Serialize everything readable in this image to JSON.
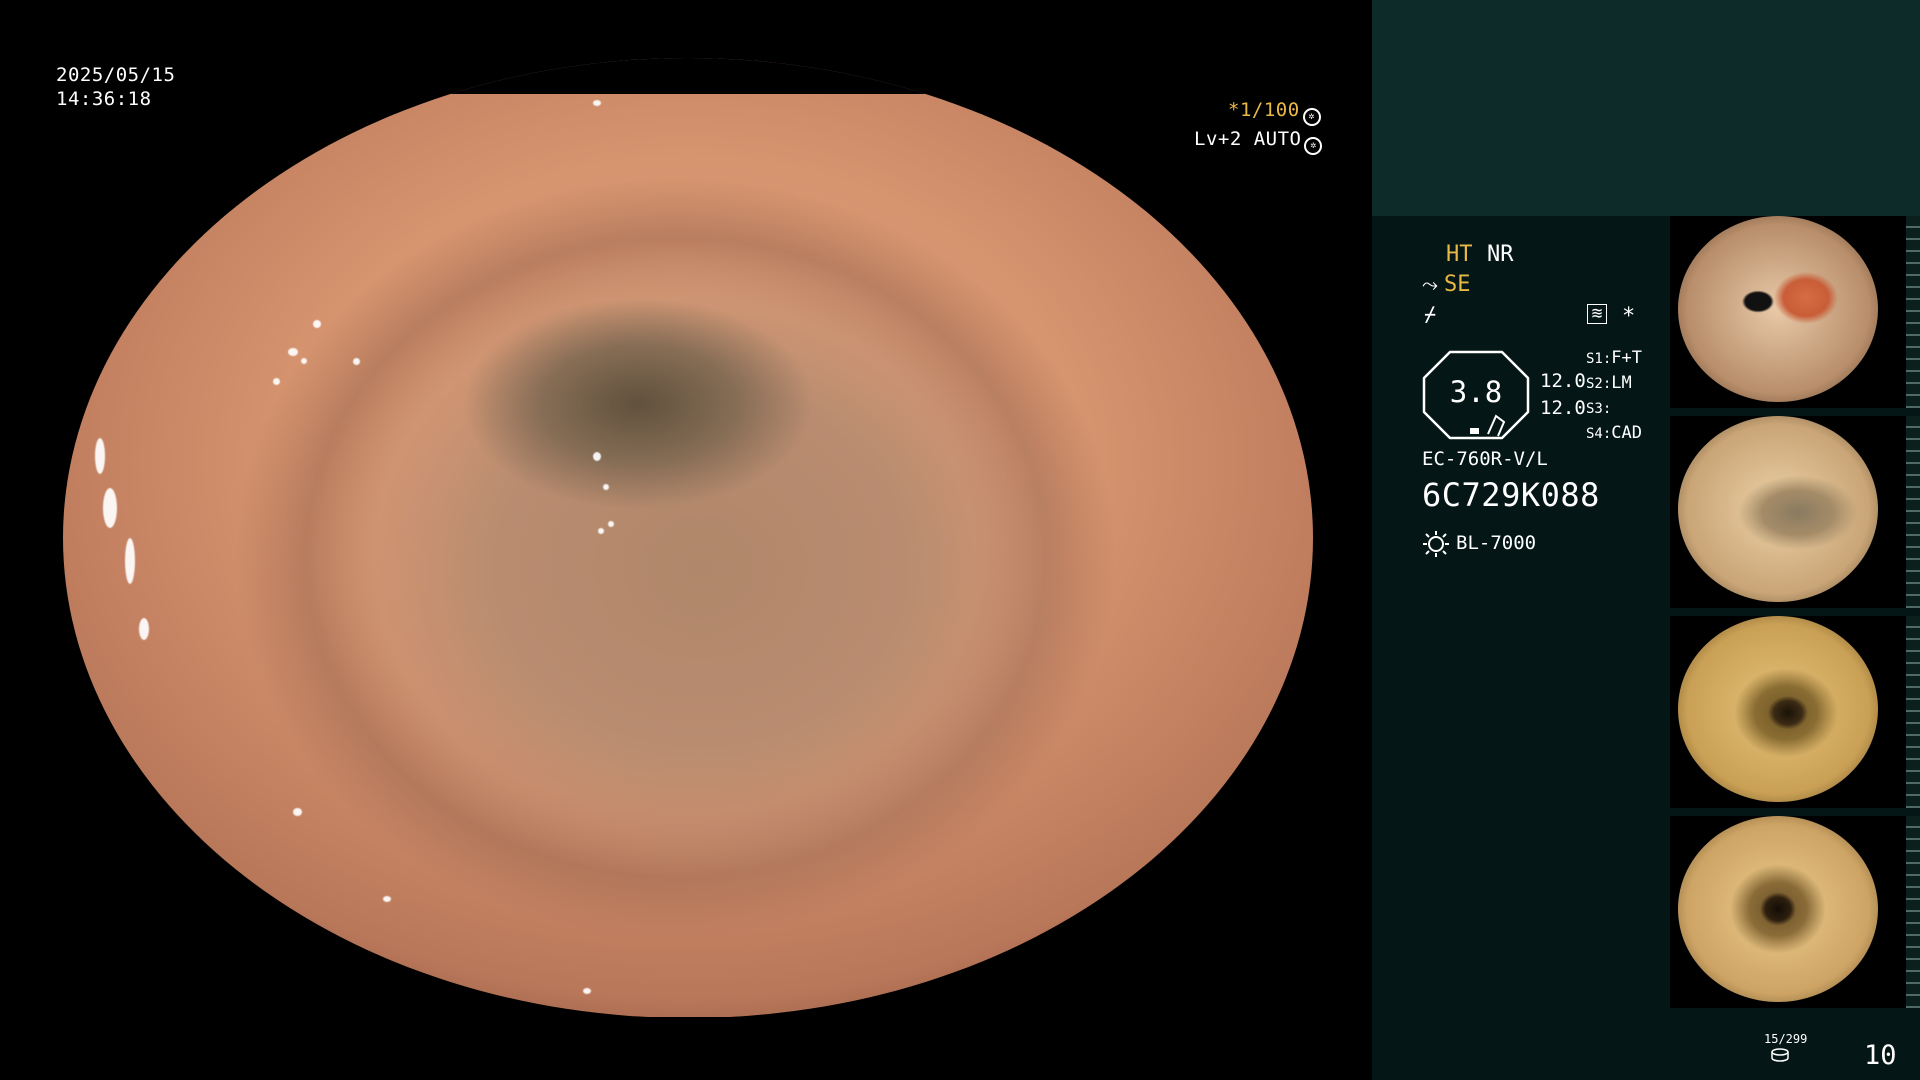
{
  "overlay": {
    "date": "2025/05/15",
    "time": "14:36:18",
    "shutter": "*1/100",
    "level": "Lv+2 AUTO"
  },
  "panel": {
    "structure_enhance": "HT",
    "noise_reduction": "NR",
    "color_mode": "SE",
    "zoom": "3.8",
    "values": [
      "12.0",
      "12.0"
    ],
    "switches": [
      {
        "key": "S1:",
        "value": "F+T"
      },
      {
        "key": "S2:",
        "value": "LM"
      },
      {
        "key": "S3:",
        "value": ""
      },
      {
        "key": "S4:",
        "value": "CAD"
      }
    ],
    "scope_model": "EC-760R-V/L",
    "scope_serial": "6C729K088",
    "light_source": "BL-7000"
  },
  "footer": {
    "storage": "15/299",
    "page": "10"
  },
  "colors": {
    "accent_yellow": "#e9b946",
    "panel_bg": "#041615",
    "panel_header_bg": "#0d2c29"
  }
}
